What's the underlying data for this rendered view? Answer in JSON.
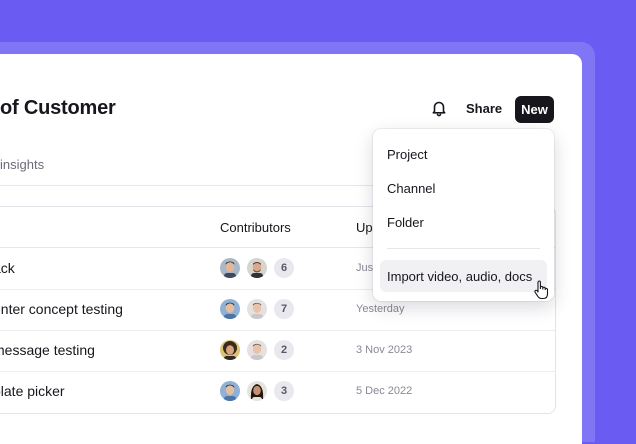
{
  "page": {
    "title": "of Customer"
  },
  "header": {
    "share_label": "Share",
    "new_label": "New",
    "icons": [
      "bell-icon"
    ]
  },
  "tabs": {
    "insights_label": "insights"
  },
  "table": {
    "columns": {
      "contributors": "Contributors",
      "updated": "Up"
    },
    "rows": [
      {
        "name": "ack",
        "count": "6",
        "date": "Jus"
      },
      {
        "name": "enter concept testing",
        "count": "7",
        "date": "Yesterday"
      },
      {
        "name": "message testing",
        "count": "2",
        "date": "3 Nov 2023"
      },
      {
        "name": "plate picker",
        "count": "3",
        "date": "5 Dec 2022"
      }
    ]
  },
  "menu": {
    "items": [
      "Project",
      "Channel",
      "Folder"
    ],
    "import_label": "Import video, audio, docs"
  },
  "colors": {
    "accent": "#6a5cf2",
    "button": "#17161d"
  }
}
